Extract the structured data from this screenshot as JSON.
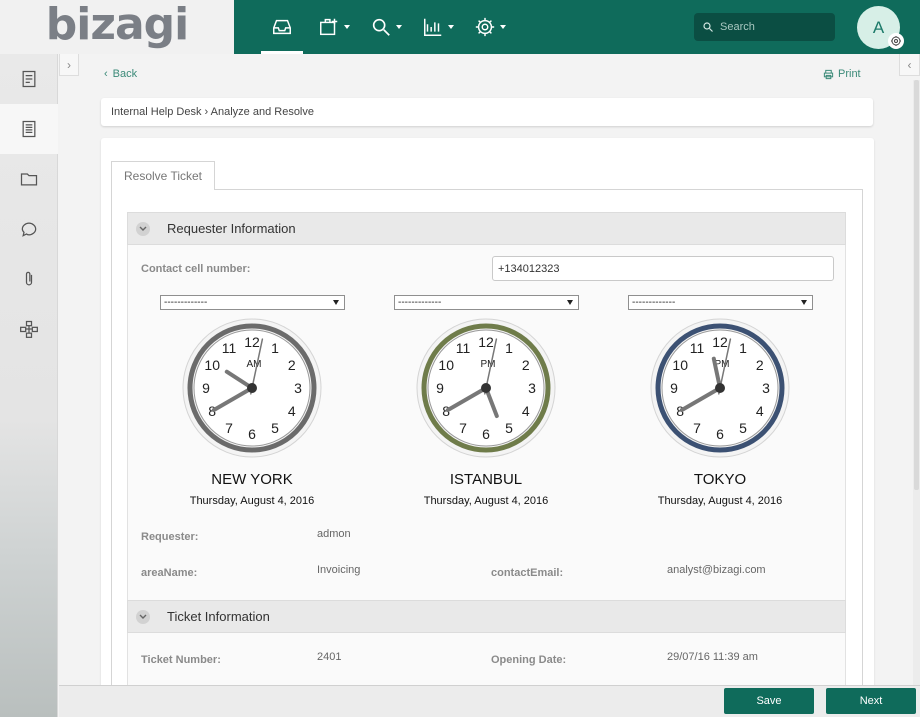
{
  "brand": {
    "logo": "bizagi"
  },
  "topnav": {
    "items": [
      {
        "icon": "inbox-icon",
        "active": true
      },
      {
        "icon": "new-case-icon",
        "dropdown": true
      },
      {
        "icon": "search-icon",
        "dropdown": true
      },
      {
        "icon": "analytics-icon",
        "dropdown": true
      },
      {
        "icon": "settings-icon",
        "dropdown": true
      }
    ],
    "search_placeholder": "Search",
    "avatar_initial": "A"
  },
  "sidebar": {
    "items": [
      {
        "icon": "form-icon"
      },
      {
        "icon": "document-icon",
        "active": true
      },
      {
        "icon": "folder-icon"
      },
      {
        "icon": "comment-icon"
      },
      {
        "icon": "attachment-icon"
      },
      {
        "icon": "process-map-icon"
      }
    ]
  },
  "header": {
    "back_label": "Back",
    "print_label": "Print",
    "breadcrumb": "Internal Help Desk › Analyze and Resolve"
  },
  "form": {
    "tab_label": "Resolve Ticket",
    "requester_section": {
      "title": "Requester Information",
      "contact_cell_label": "Contact cell number:",
      "contact_cell_value": "+134012323",
      "requester_label": "Requester:",
      "requester_value": "admon",
      "area_label": "areaName:",
      "area_value": "Invoicing",
      "email_label": "contactEmail:",
      "email_value": "analyst@bizagi.com"
    },
    "clocks": [
      {
        "select_value": "-------------",
        "period": "AM",
        "city": "NEW YORK",
        "date": "Thursday, August 4, 2016",
        "ring_color": "#6b6b6b",
        "hour": 10.1,
        "minute": 40,
        "second": 2
      },
      {
        "select_value": "-------------",
        "period": "PM",
        "city": "ISTANBUL",
        "date": "Thursday, August 4, 2016",
        "ring_color": "#6f7c4a",
        "hour": 5.3,
        "minute": 40,
        "second": 2
      },
      {
        "select_value": "-------------",
        "period": "PM",
        "city": "TOKYO",
        "date": "Thursday, August 4, 2016",
        "ring_color": "#3c5173",
        "hour": 11.6,
        "minute": 40,
        "second": 2
      }
    ],
    "ticket_section": {
      "title": "Ticket Information",
      "ticket_number_label": "Ticket Number:",
      "ticket_number_value": "2401",
      "opening_date_label": "Opening Date:",
      "opening_date_value": "29/07/16 11:39 am"
    }
  },
  "actions": {
    "save_label": "Save",
    "next_label": "Next"
  }
}
